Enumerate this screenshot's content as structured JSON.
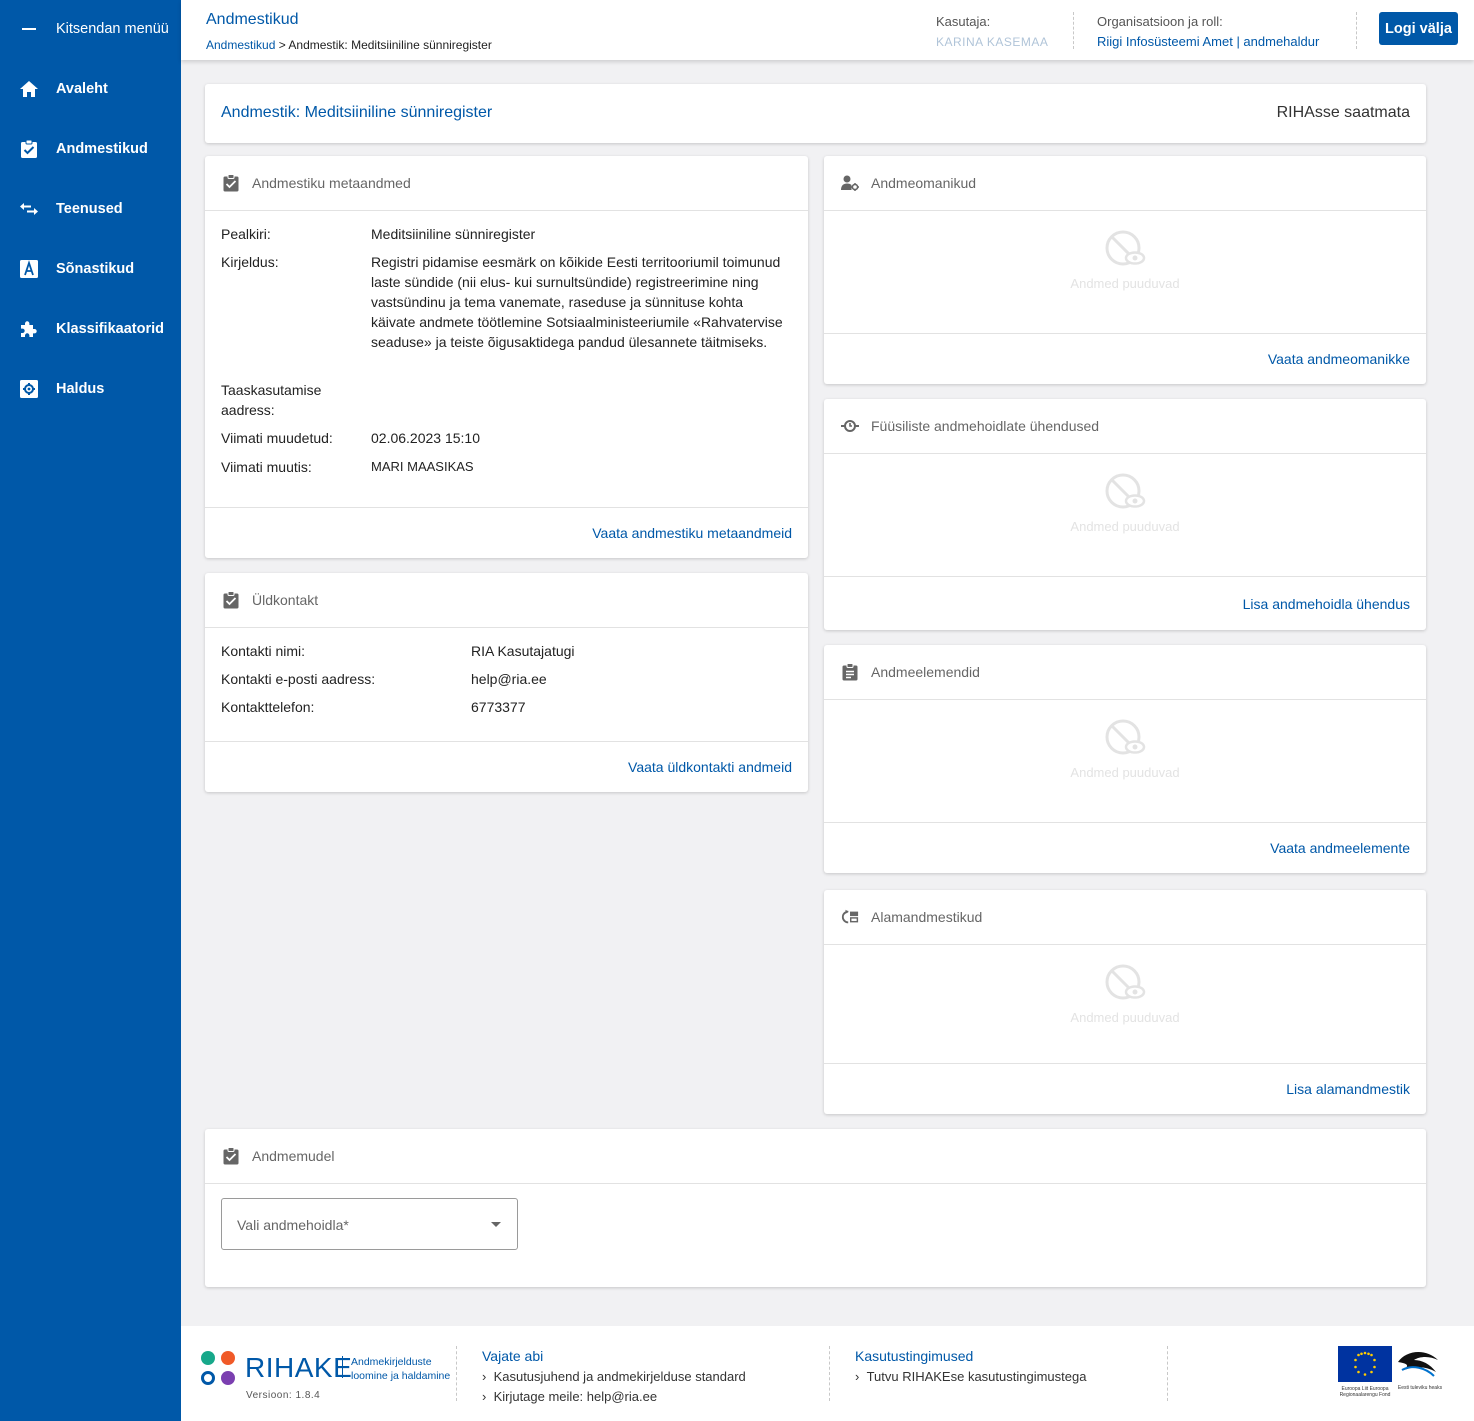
{
  "sidebar": {
    "collapse_label": "Kitsendan menüü",
    "items": [
      {
        "label": "Avaleht",
        "icon": "home-icon"
      },
      {
        "label": "Andmestikud",
        "icon": "clipboard-check-icon"
      },
      {
        "label": "Teenused",
        "icon": "swap-arrows-icon"
      },
      {
        "label": "Sõnastikud",
        "icon": "letter-a-icon"
      },
      {
        "label": "Klassifikaatorid",
        "icon": "puzzle-icon"
      },
      {
        "label": "Haldus",
        "icon": "settings-box-icon"
      }
    ]
  },
  "header": {
    "title": "Andmestikud",
    "breadcrumb_link": "Andmestikud",
    "breadcrumb_sep": " > ",
    "breadcrumb_current": "Andmestik: Meditsiiniline sünniregister",
    "user_label": "Kasutaja:",
    "user_value": "KARINA KASEMAA",
    "org_label": "Organisatsioon ja roll:",
    "org_value": "Riigi Infosüsteemi Amet | andmehaldur",
    "logout_label": "Logi välja"
  },
  "dataset": {
    "title": "Andmestik: Meditsiiniline sünniregister",
    "status": "RIHAsse saatmata"
  },
  "metadata_card": {
    "title": "Andmestiku metaandmed",
    "fields": [
      {
        "label": "Pealkiri:",
        "value": "Meditsiiniline sünniregister"
      },
      {
        "label": "Kirjeldus:",
        "value": "Registri pidamise eesmärk on kõikide Eesti territooriumil toimunud laste sündide (nii elus- kui surnultsündide) registreerimine ning vastsündinu ja tema vanemate, raseduse ja sünnituse kohta käivate andmete töötlemine Sotsiaalministeeriumile «Rahvatervise seaduse» ja teiste õigusaktidega pandud ülesannete täitmiseks."
      },
      {
        "label": "Taaskasutamise aadress:",
        "value": ""
      },
      {
        "label": "Viimati muudetud:",
        "value": "02.06.2023 15:10"
      },
      {
        "label": "Viimati muutis:",
        "value": "MARI MAASIKAS"
      }
    ],
    "footer_link": "Vaata andmestiku metaandmeid"
  },
  "contact_card": {
    "title": "Üldkontakt",
    "fields": [
      {
        "label": "Kontakti nimi:",
        "value": "RIA Kasutajatugi"
      },
      {
        "label": "Kontakti e-posti aadress:",
        "value": "help@ria.ee"
      },
      {
        "label": "Kontakttelefon:",
        "value": "6773377"
      }
    ],
    "footer_link": "Vaata üldkontakti andmeid"
  },
  "owners_card": {
    "title": "Andmeomanikud",
    "empty_text": "Andmed puuduvad",
    "footer_link": "Vaata andmeomanikke"
  },
  "connections_card": {
    "title": "Füüsiliste andmehoidlate ühendused",
    "empty_text": "Andmed puuduvad",
    "footer_link": "Lisa andmehoidla ühendus"
  },
  "elements_card": {
    "title": "Andmeelemendid",
    "empty_text": "Andmed puuduvad",
    "footer_link": "Vaata andmeelemente"
  },
  "subsets_card": {
    "title": "Alamandmestikud",
    "empty_text": "Andmed puuduvad",
    "footer_link": "Lisa alamandmestik"
  },
  "model_card": {
    "title": "Andmemudel",
    "select_placeholder": "Vali andmehoidla*"
  },
  "footer": {
    "brand": "RIHAKE",
    "tagline_1": "Andmekirjelduste",
    "tagline_2": "loomine ja haldamine",
    "version": "Versioon: 1.8.4",
    "help_title": "Vajate abi",
    "help_link_1": "Kasutusjuhend ja andmekirjelduse standard",
    "help_link_2": "Kirjutage meile: help@ria.ee",
    "terms_title": "Kasutustingimused",
    "terms_link": "Tutvu RIHAKEse kasutustingimustega",
    "eu_text": "Euroopa Liit Euroopa Regionaalarengu Fond",
    "ee_text": "Eesti tuleviku heaks"
  },
  "colors": {
    "primary": "#0058a8",
    "background": "#f1f1f3"
  }
}
